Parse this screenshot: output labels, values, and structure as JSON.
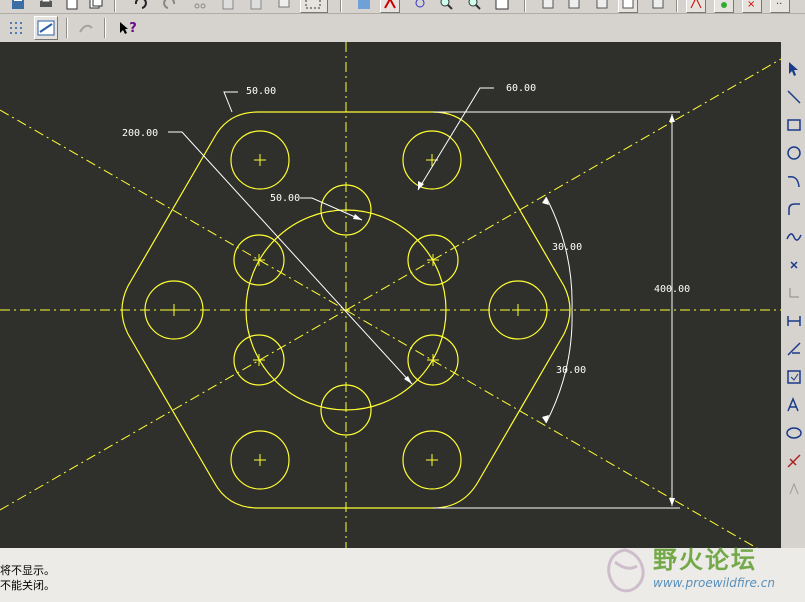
{
  "toolbar_top": {
    "icons": [
      "save-icon",
      "print-icon",
      "page-setup-icon",
      "copy-icon",
      "undo-icon",
      "redo-icon",
      "cut-icon",
      "paste-icon",
      "paste-special-icon",
      "regenerate-icon",
      "select-box-icon",
      "refit-icon",
      "sketch-icon",
      "spin-center-icon",
      "zoom-in-icon",
      "zoom-out-icon",
      "zoom-fit-icon",
      "orient-icon",
      "saved-view-icon",
      "layers-icon",
      "model-tree-icon",
      "dimension-display-icon",
      "constraint-display-icon",
      "grid-display-icon",
      "vertex-display-icon"
    ]
  },
  "toolbar_second": {
    "icons": [
      "grid-toggle-icon",
      "sketch-view-icon",
      "disabled-tool-icon",
      "context-help-icon"
    ],
    "help_label": "?"
  },
  "sketch": {
    "background": "#2f2f2b",
    "geometry_color": "#ffff33",
    "centerline_color": "#ffff33",
    "dimension_color": "#ffffff",
    "dimensions": {
      "top_radius": "50.00",
      "hole_diameter": "60.00",
      "pattern_diameter": "200.00",
      "inner_radius": "50.00",
      "angle_upper": "30.00",
      "angle_lower": "30.00",
      "overall_height": "400.00"
    }
  },
  "right_toolbar": {
    "tools": [
      "select-arrow-icon",
      "line-tool-icon",
      "rectangle-tool-icon",
      "circle-tool-icon",
      "arc-tool-icon",
      "fillet-tool-icon",
      "spline-tool-icon",
      "point-tool-icon",
      "coordinate-system-icon",
      "dimension-tool-icon",
      "modify-tool-icon",
      "constraints-tool-icon",
      "text-tool-icon",
      "palette-tool-icon",
      "trim-tool-icon",
      "mirror-tool-icon"
    ]
  },
  "status": {
    "line1": "将不显示。",
    "line2": "不能关闭。"
  },
  "watermark": {
    "title": "野火论坛",
    "url": "www.proewildfire.cn"
  }
}
